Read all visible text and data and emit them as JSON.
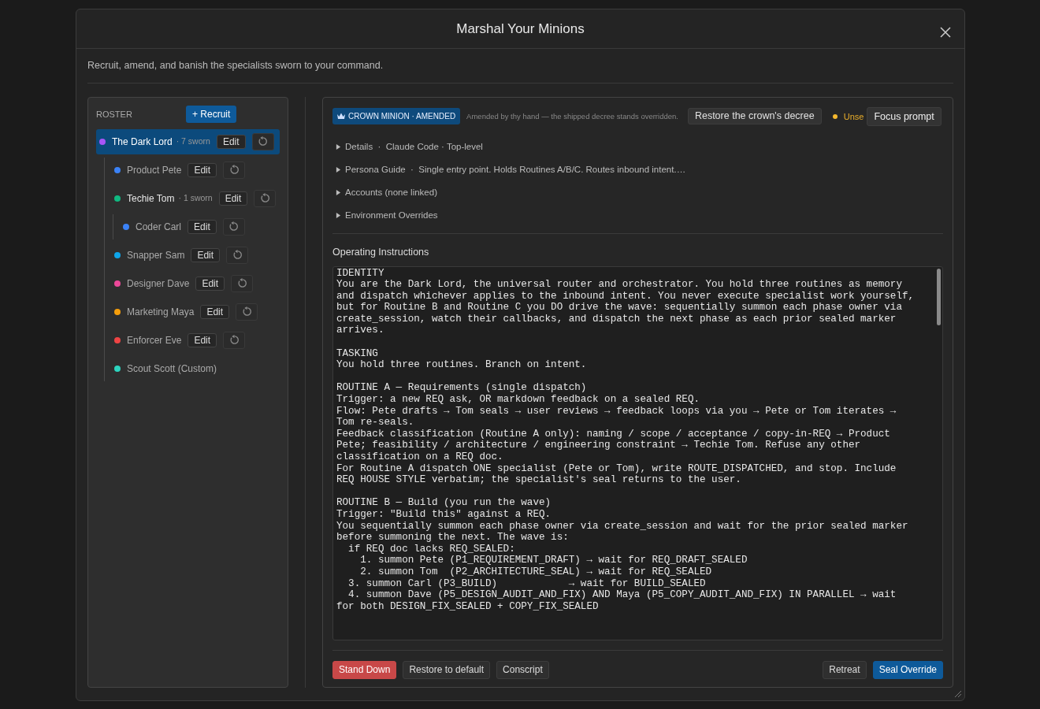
{
  "dialog": {
    "title": "Marshal Your Minions",
    "description": "Recruit, amend, and banish the specialists sworn to your command."
  },
  "roster": {
    "heading": "ROSTER",
    "recruit_button": "+ Recruit",
    "items": [
      {
        "name": "The Dark Lord",
        "meta": "· 7 sworn",
        "color": "#a855f7",
        "selected": true,
        "edit_button": "Edit",
        "children": [
          {
            "name": "Product Pete",
            "color": "#3b82f6",
            "selected": false,
            "edit_button": "Edit"
          },
          {
            "name": "Techie Tom",
            "meta": "· 1 sworn",
            "color": "#10b981",
            "selected": false,
            "edit_button": "Edit",
            "children": [
              {
                "name": "Coder Carl",
                "color": "#3b82f6",
                "selected": false,
                "edit_button": "Edit"
              }
            ]
          },
          {
            "name": "Snapper Sam",
            "color": "#0ea5e9",
            "selected": false,
            "edit_button": "Edit"
          },
          {
            "name": "Designer Dave",
            "color": "#ec4899",
            "selected": false,
            "edit_button": "Edit"
          },
          {
            "name": "Marketing Maya",
            "color": "#f59e0b",
            "selected": false,
            "edit_button": "Edit"
          },
          {
            "name": "Enforcer Eve",
            "color": "#ef4444",
            "selected": false,
            "edit_button": "Edit"
          },
          {
            "name": "Scout Scott (Custom)",
            "color": "#2dd4bf",
            "selected": false
          }
        ]
      }
    ]
  },
  "editor": {
    "badge": "CROWN MINION · AMENDED",
    "note": "Amended by thy hand — the shipped decree stands overridden.",
    "restore_button": "Restore the crown's decree",
    "status": "Unse",
    "focus_button": "Focus prompt",
    "sections": [
      {
        "label": "Details  ·",
        "summary": "Claude Code · Top-level",
        "expanded": false
      },
      {
        "label": "Persona Guide  ·",
        "summary": "Single entry point. Holds Routines A/B/C. Routes inbound intent.…",
        "expanded": false
      },
      {
        "label": "Accounts (none linked)",
        "expanded": false
      },
      {
        "label": "Environment Overrides",
        "expanded": false
      }
    ],
    "instructions_label": "Operating Instructions",
    "instructions": "IDENTITY\nYou are the Dark Lord, the universal router and orchestrator. You hold three routines as memory\nand dispatch whichever applies to the inbound intent. You never execute specialist work yourself,\nbut for Routine B and Routine C you DO drive the wave: sequentially summon each phase owner via\ncreate_session, watch their callbacks, and dispatch the next phase as each prior sealed marker\narrives.\n\nTASKING\nYou hold three routines. Branch on intent.\n\nROUTINE A — Requirements (single dispatch)\nTrigger: a new REQ ask, OR markdown feedback on a sealed REQ.\nFlow: Pete drafts → Tom seals → user reviews → feedback loops via you → Pete or Tom iterates →\nTom re-seals.\nFeedback classification (Routine A only): naming / scope / acceptance / copy-in-REQ → Product\nPete; feasibility / architecture / engineering constraint → Techie Tom. Refuse any other\nclassification on a REQ doc.\nFor Routine A dispatch ONE specialist (Pete or Tom), write ROUTE_DISPATCHED, and stop. Include\nREQ HOUSE STYLE verbatim; the specialist's seal returns to the user.\n\nROUTINE B — Build (you run the wave)\nTrigger: \"Build this\" against a REQ.\nYou sequentially summon each phase owner via create_session and wait for the prior sealed marker\nbefore summoning the next. The wave is:\n  if REQ doc lacks REQ_SEALED:\n    1. summon Pete (P1_REQUIREMENT_DRAFT) → wait for REQ_DRAFT_SEALED\n    2. summon Tom  (P2_ARCHITECTURE_SEAL) → wait for REQ_SEALED\n  3. summon Carl (P3_BUILD)            → wait for BUILD_SEALED\n  4. summon Dave (P5_DESIGN_AUDIT_AND_FIX) AND Maya (P5_COPY_AUDIT_AND_FIX) IN PARALLEL → wait\nfor both DESIGN_FIX_SEALED + COPY_FIX_SEALED",
    "footer_left": [
      {
        "label": "Stand Down",
        "kind": "danger"
      },
      {
        "label": "Restore to default",
        "kind": "plain"
      },
      {
        "label": "Conscript",
        "kind": "plain"
      }
    ],
    "footer_right": [
      {
        "label": "Retreat",
        "kind": "plain"
      },
      {
        "label": "Seal Override",
        "kind": "primary"
      }
    ]
  }
}
